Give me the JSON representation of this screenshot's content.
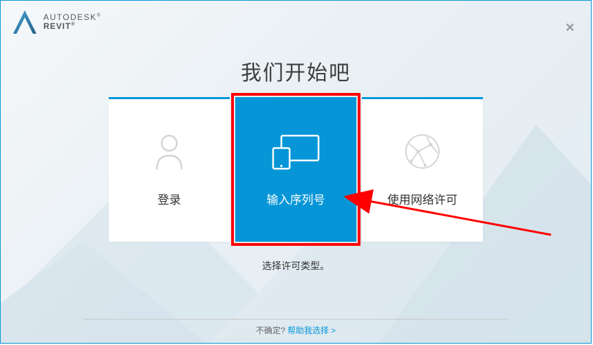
{
  "brand": {
    "autodesk": "AUTODESK",
    "revit": "REVIT"
  },
  "close": "×",
  "title": "我们开始吧",
  "cards": {
    "signin": {
      "label": "登录"
    },
    "serial": {
      "label": "输入序列号"
    },
    "network": {
      "label": "使用网络许可"
    }
  },
  "subtitle": "选择许可类型。",
  "footer": {
    "prefix": "不确定? ",
    "link": "帮助我选择",
    "suffix": " >"
  }
}
